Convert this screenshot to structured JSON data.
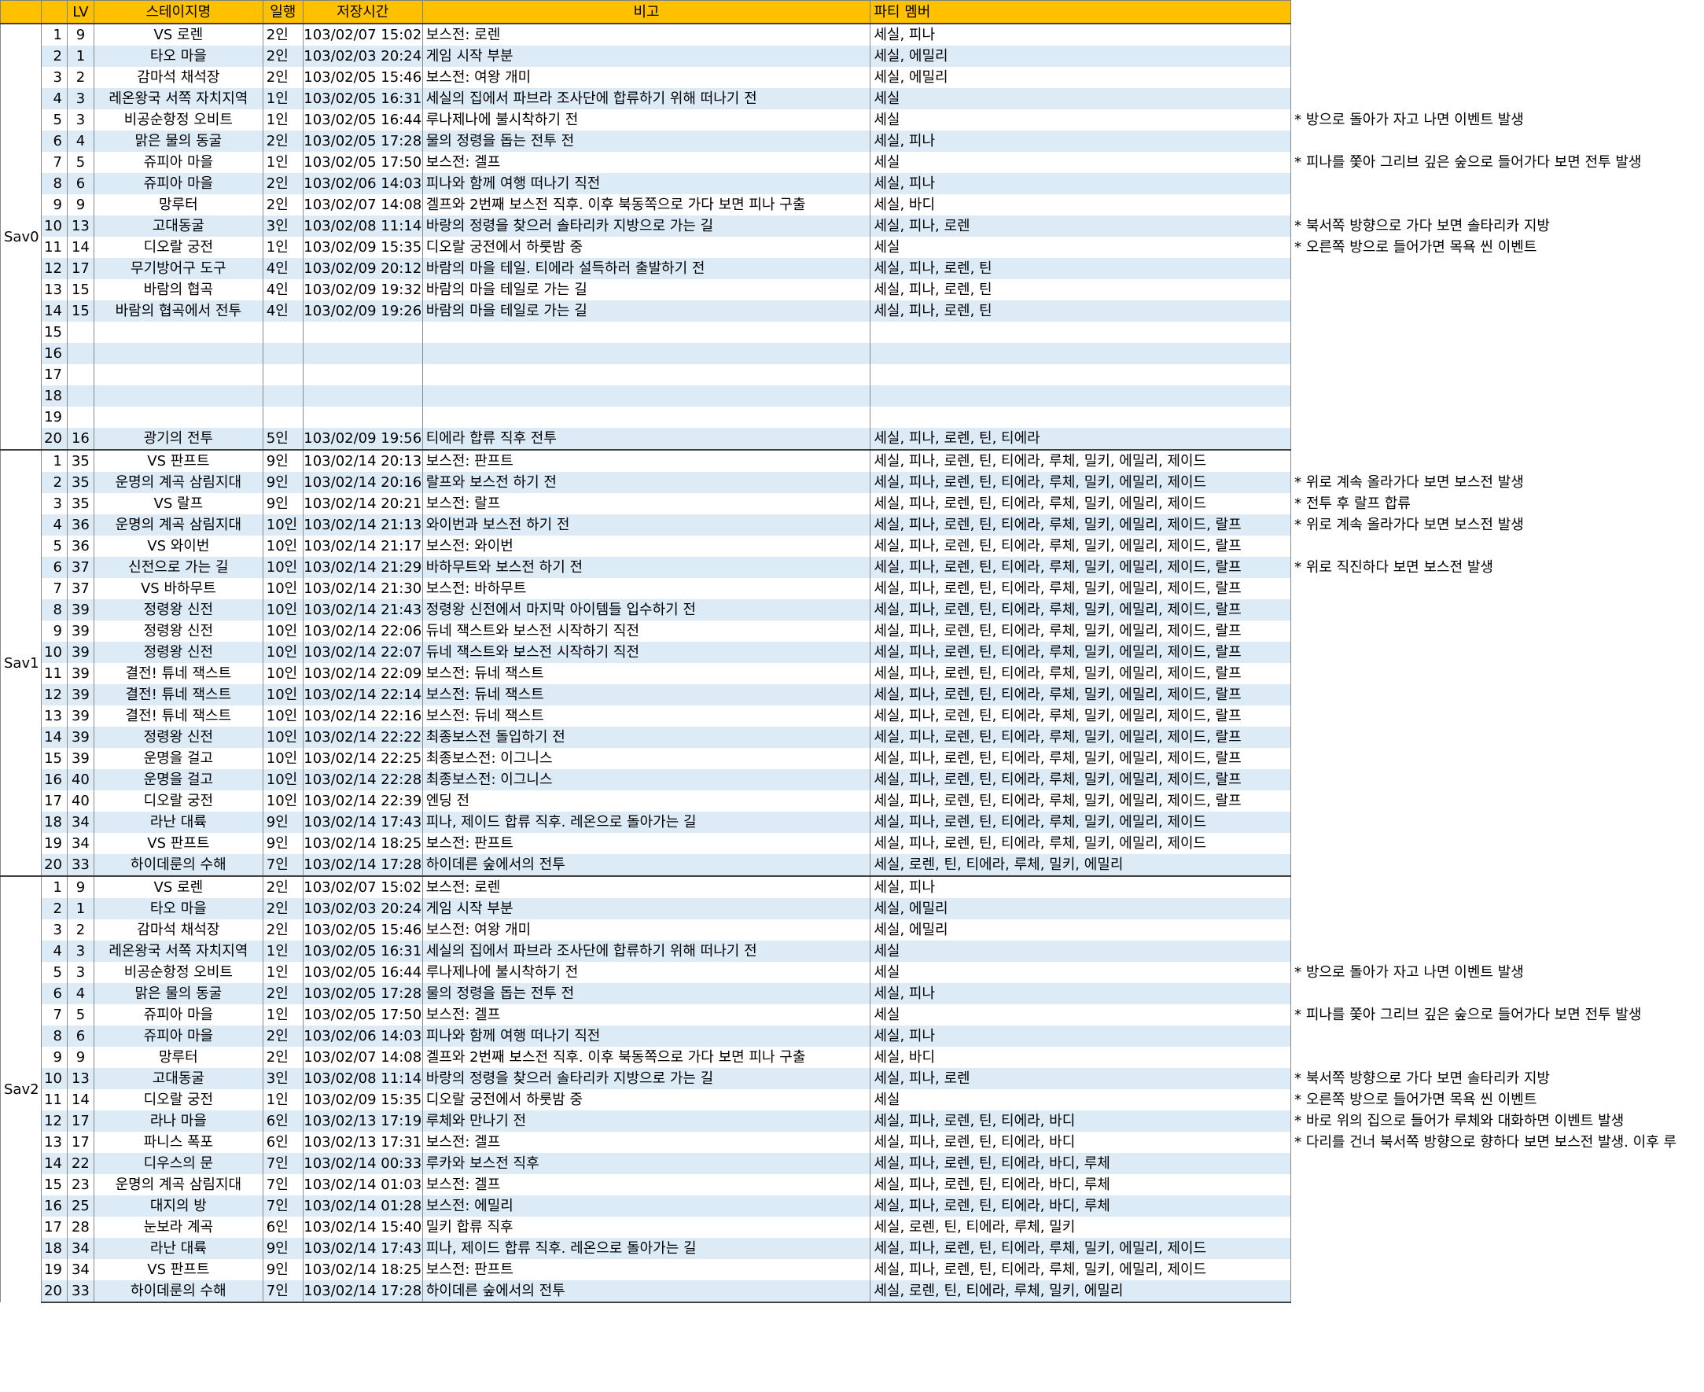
{
  "headers": {
    "blank": "",
    "no": "",
    "lv": "LV",
    "stage": "스테이지명",
    "party_count": "일행",
    "save_time": "저장시간",
    "remark": "비고",
    "party": "파티 멤버"
  },
  "groups": [
    {
      "name": "Sav0",
      "rows": [
        {
          "no": "1",
          "lv": "9",
          "stage": "VS 로렌",
          "cnt": "2인",
          "time": "103/02/07 15:02",
          "remark": "보스전: 로렌",
          "party": "세실, 피나",
          "note": ""
        },
        {
          "no": "2",
          "lv": "1",
          "stage": "타오 마을",
          "cnt": "2인",
          "time": "103/02/03 20:24",
          "remark": "게임 시작 부분",
          "party": "세실, 에밀리",
          "note": ""
        },
        {
          "no": "3",
          "lv": "2",
          "stage": "감마석 채석장",
          "cnt": "2인",
          "time": "103/02/05 15:46",
          "remark": "보스전: 여왕 개미",
          "party": "세실, 에밀리",
          "note": ""
        },
        {
          "no": "4",
          "lv": "3",
          "stage": "레온왕국 서쪽 자치지역",
          "cnt": "1인",
          "time": "103/02/05 16:31",
          "remark": "세실의 집에서 파브라 조사단에 합류하기 위해 떠나기 전",
          "party": "세실",
          "note": ""
        },
        {
          "no": "5",
          "lv": "3",
          "stage": "비공순항정 오비트",
          "cnt": "1인",
          "time": "103/02/05 16:44",
          "remark": "루나제나에 불시착하기 전",
          "party": "세실",
          "note": "* 방으로 돌아가 자고 나면 이벤트 발생"
        },
        {
          "no": "6",
          "lv": "4",
          "stage": "맑은 물의 동굴",
          "cnt": "2인",
          "time": "103/02/05 17:28",
          "remark": "물의 정령을 돕는 전투 전",
          "party": "세실, 피나",
          "note": ""
        },
        {
          "no": "7",
          "lv": "5",
          "stage": "쥬피아 마을",
          "cnt": "1인",
          "time": "103/02/05 17:50",
          "remark": "보스전: 겔프",
          "party": "세실",
          "note": "* 피나를 쫓아 그리브 깊은 숲으로 들어가다 보면 전투 발생"
        },
        {
          "no": "8",
          "lv": "6",
          "stage": "쥬피아 마을",
          "cnt": "2인",
          "time": "103/02/06 14:03",
          "remark": "피나와 함께 여행 떠나기 직전",
          "party": "세실, 피나",
          "note": ""
        },
        {
          "no": "9",
          "lv": "9",
          "stage": "망루터",
          "cnt": "2인",
          "time": "103/02/07 14:08",
          "remark": "겔프와 2번째 보스전 직후. 이후 북동쪽으로 가다 보면 피나 구출",
          "party": "세실, 바디",
          "note": ""
        },
        {
          "no": "10",
          "lv": "13",
          "stage": "고대동굴",
          "cnt": "3인",
          "time": "103/02/08 11:14",
          "remark": "바랑의 정령을 찾으러 솔타리카 지방으로 가는 길",
          "party": "세실, 피나, 로렌",
          "note": "* 북서쪽 방향으로 가다 보면 솔타리카 지방"
        },
        {
          "no": "11",
          "lv": "14",
          "stage": "디오랄 궁전",
          "cnt": "1인",
          "time": "103/02/09 15:35",
          "remark": "디오랄 궁전에서 하룻밤 중",
          "party": "세실",
          "note": "* 오른쪽 방으로 들어가면 목욕 씬 이벤트"
        },
        {
          "no": "12",
          "lv": "17",
          "stage": "무기방어구 도구",
          "cnt": "4인",
          "time": "103/02/09 20:12",
          "remark": "바람의 마을 테일. 티에라 설득하러 출발하기 전",
          "party": "세실, 피나, 로렌, 틴",
          "note": ""
        },
        {
          "no": "13",
          "lv": "15",
          "stage": "바람의 협곡",
          "cnt": "4인",
          "time": "103/02/09 19:32",
          "remark": "바람의 마을 테일로 가는 길",
          "party": "세실, 피나, 로렌, 틴",
          "note": ""
        },
        {
          "no": "14",
          "lv": "15",
          "stage": "바람의 협곡에서 전투",
          "cnt": "4인",
          "time": "103/02/09 19:26",
          "remark": "바람의 마을 테일로 가는 길",
          "party": "세실, 피나, 로렌, 틴",
          "note": ""
        },
        {
          "no": "15",
          "lv": "",
          "stage": "",
          "cnt": "",
          "time": "",
          "remark": "",
          "party": "",
          "note": ""
        },
        {
          "no": "16",
          "lv": "",
          "stage": "",
          "cnt": "",
          "time": "",
          "remark": "",
          "party": "",
          "note": ""
        },
        {
          "no": "17",
          "lv": "",
          "stage": "",
          "cnt": "",
          "time": "",
          "remark": "",
          "party": "",
          "note": ""
        },
        {
          "no": "18",
          "lv": "",
          "stage": "",
          "cnt": "",
          "time": "",
          "remark": "",
          "party": "",
          "note": ""
        },
        {
          "no": "19",
          "lv": "",
          "stage": "",
          "cnt": "",
          "time": "",
          "remark": "",
          "party": "",
          "note": ""
        },
        {
          "no": "20",
          "lv": "16",
          "stage": "광기의 전투",
          "cnt": "5인",
          "time": "103/02/09 19:56",
          "remark": "티에라 합류 직후 전투",
          "party": "세실, 피나, 로렌, 틴, 티에라",
          "note": ""
        }
      ]
    },
    {
      "name": "Sav1",
      "rows": [
        {
          "no": "1",
          "lv": "35",
          "stage": "VS 판프트",
          "cnt": "9인",
          "time": "103/02/14 20:13",
          "remark": "보스전: 판프트",
          "party": "세실, 피나, 로렌, 틴, 티에라, 루체, 밀키, 에밀리, 제이드",
          "note": ""
        },
        {
          "no": "2",
          "lv": "35",
          "stage": "운명의 계곡 삼림지대",
          "cnt": "9인",
          "time": "103/02/14 20:16",
          "remark": "랄프와 보스전 하기 전",
          "party": "세실, 피나, 로렌, 틴, 티에라, 루체, 밀키, 에밀리, 제이드",
          "note": "* 위로 계속 올라가다 보면 보스전 발생"
        },
        {
          "no": "3",
          "lv": "35",
          "stage": "VS 랄프",
          "cnt": "9인",
          "time": "103/02/14 20:21",
          "remark": "보스전: 랄프",
          "party": "세실, 피나, 로렌, 틴, 티에라, 루체, 밀키, 에밀리, 제이드",
          "note": "* 전투 후 랄프 합류"
        },
        {
          "no": "4",
          "lv": "36",
          "stage": "운명의 계곡 삼림지대",
          "cnt": "10인",
          "time": "103/02/14 21:13",
          "remark": "와이번과 보스전 하기 전",
          "party": "세실, 피나, 로렌, 틴, 티에라, 루체, 밀키, 에밀리, 제이드, 랄프",
          "note": "* 위로 계속 올라가다 보면 보스전 발생"
        },
        {
          "no": "5",
          "lv": "36",
          "stage": "VS 와이번",
          "cnt": "10인",
          "time": "103/02/14 21:17",
          "remark": "보스전: 와이번",
          "party": "세실, 피나, 로렌, 틴, 티에라, 루체, 밀키, 에밀리, 제이드, 랄프",
          "note": ""
        },
        {
          "no": "6",
          "lv": "37",
          "stage": "신전으로 가는 길",
          "cnt": "10인",
          "time": "103/02/14 21:29",
          "remark": "바하무트와 보스전 하기 전",
          "party": "세실, 피나, 로렌, 틴, 티에라, 루체, 밀키, 에밀리, 제이드, 랄프",
          "note": "* 위로 직진하다 보면 보스전 발생"
        },
        {
          "no": "7",
          "lv": "37",
          "stage": "VS 바하무트",
          "cnt": "10인",
          "time": "103/02/14 21:30",
          "remark": "보스전: 바하무트",
          "party": "세실, 피나, 로렌, 틴, 티에라, 루체, 밀키, 에밀리, 제이드, 랄프",
          "note": ""
        },
        {
          "no": "8",
          "lv": "39",
          "stage": "정령왕 신전",
          "cnt": "10인",
          "time": "103/02/14 21:43",
          "remark": "정령왕 신전에서 마지막 아이템들 입수하기 전",
          "party": "세실, 피나, 로렌, 틴, 티에라, 루체, 밀키, 에밀리, 제이드, 랄프",
          "note": ""
        },
        {
          "no": "9",
          "lv": "39",
          "stage": "정령왕 신전",
          "cnt": "10인",
          "time": "103/02/14 22:06",
          "remark": "듀네 잭스트와 보스전 시작하기 직전",
          "party": "세실, 피나, 로렌, 틴, 티에라, 루체, 밀키, 에밀리, 제이드, 랄프",
          "note": ""
        },
        {
          "no": "10",
          "lv": "39",
          "stage": "정령왕 신전",
          "cnt": "10인",
          "time": "103/02/14 22:07",
          "remark": "듀네 잭스트와 보스전 시작하기 직전",
          "party": "세실, 피나, 로렌, 틴, 티에라, 루체, 밀키, 에밀리, 제이드, 랄프",
          "note": ""
        },
        {
          "no": "11",
          "lv": "39",
          "stage": "결전! 튜네 잭스트",
          "cnt": "10인",
          "time": "103/02/14 22:09",
          "remark": "보스전: 듀네 잭스트",
          "party": "세실, 피나, 로렌, 틴, 티에라, 루체, 밀키, 에밀리, 제이드, 랄프",
          "note": ""
        },
        {
          "no": "12",
          "lv": "39",
          "stage": "결전! 튜네 잭스트",
          "cnt": "10인",
          "time": "103/02/14 22:14",
          "remark": "보스전: 듀네 잭스트",
          "party": "세실, 피나, 로렌, 틴, 티에라, 루체, 밀키, 에밀리, 제이드, 랄프",
          "note": ""
        },
        {
          "no": "13",
          "lv": "39",
          "stage": "결전! 튜네 잭스트",
          "cnt": "10인",
          "time": "103/02/14 22:16",
          "remark": "보스전: 듀네 잭스트",
          "party": "세실, 피나, 로렌, 틴, 티에라, 루체, 밀키, 에밀리, 제이드, 랄프",
          "note": ""
        },
        {
          "no": "14",
          "lv": "39",
          "stage": "정령왕 신전",
          "cnt": "10인",
          "time": "103/02/14 22:22",
          "remark": "최종보스전 돌입하기 전",
          "party": "세실, 피나, 로렌, 틴, 티에라, 루체, 밀키, 에밀리, 제이드, 랄프",
          "note": ""
        },
        {
          "no": "15",
          "lv": "39",
          "stage": "운명을 걸고",
          "cnt": "10인",
          "time": "103/02/14 22:25",
          "remark": "최종보스전: 이그니스",
          "party": "세실, 피나, 로렌, 틴, 티에라, 루체, 밀키, 에밀리, 제이드, 랄프",
          "note": ""
        },
        {
          "no": "16",
          "lv": "40",
          "stage": "운명을 걸고",
          "cnt": "10인",
          "time": "103/02/14 22:28",
          "remark": "최종보스전: 이그니스",
          "party": "세실, 피나, 로렌, 틴, 티에라, 루체, 밀키, 에밀리, 제이드, 랄프",
          "note": ""
        },
        {
          "no": "17",
          "lv": "40",
          "stage": "디오랄 궁전",
          "cnt": "10인",
          "time": "103/02/14 22:39",
          "remark": "엔딩 전",
          "party": "세실, 피나, 로렌, 틴, 티에라, 루체, 밀키, 에밀리, 제이드, 랄프",
          "note": ""
        },
        {
          "no": "18",
          "lv": "34",
          "stage": "라난 대륙",
          "cnt": "9인",
          "time": "103/02/14 17:43",
          "remark": "피나, 제이드 합류 직후. 레온으로 돌아가는 길",
          "party": "세실, 피나, 로렌, 틴, 티에라, 루체, 밀키, 에밀리, 제이드",
          "note": ""
        },
        {
          "no": "19",
          "lv": "34",
          "stage": "VS 판프트",
          "cnt": "9인",
          "time": "103/02/14 18:25",
          "remark": "보스전: 판프트",
          "party": "세실, 피나, 로렌, 틴, 티에라, 루체, 밀키, 에밀리, 제이드",
          "note": ""
        },
        {
          "no": "20",
          "lv": "33",
          "stage": "하이데룬의 수해",
          "cnt": "7인",
          "time": "103/02/14 17:28",
          "remark": "하이데른 숲에서의 전투",
          "party": "세실, 로렌, 틴, 티에라, 루체, 밀키, 에밀리",
          "note": ""
        }
      ]
    },
    {
      "name": "Sav2",
      "rows": [
        {
          "no": "1",
          "lv": "9",
          "stage": "VS 로렌",
          "cnt": "2인",
          "time": "103/02/07 15:02",
          "remark": "보스전: 로렌",
          "party": "세실, 피나",
          "note": ""
        },
        {
          "no": "2",
          "lv": "1",
          "stage": "타오 마을",
          "cnt": "2인",
          "time": "103/02/03 20:24",
          "remark": "게임 시작 부분",
          "party": "세실, 에밀리",
          "note": ""
        },
        {
          "no": "3",
          "lv": "2",
          "stage": "감마석 채석장",
          "cnt": "2인",
          "time": "103/02/05 15:46",
          "remark": "보스전: 여왕 개미",
          "party": "세실, 에밀리",
          "note": ""
        },
        {
          "no": "4",
          "lv": "3",
          "stage": "레온왕국 서쪽 자치지역",
          "cnt": "1인",
          "time": "103/02/05 16:31",
          "remark": "세실의 집에서 파브라 조사단에 합류하기 위해 떠나기 전",
          "party": "세실",
          "note": ""
        },
        {
          "no": "5",
          "lv": "3",
          "stage": "비공순항정 오비트",
          "cnt": "1인",
          "time": "103/02/05 16:44",
          "remark": "루나제나에 불시착하기 전",
          "party": "세실",
          "note": "* 방으로 돌아가 자고 나면 이벤트 발생"
        },
        {
          "no": "6",
          "lv": "4",
          "stage": "맑은 물의 동굴",
          "cnt": "2인",
          "time": "103/02/05 17:28",
          "remark": "물의 정령을 돕는 전투 전",
          "party": "세실, 피나",
          "note": ""
        },
        {
          "no": "7",
          "lv": "5",
          "stage": "쥬피아 마을",
          "cnt": "1인",
          "time": "103/02/05 17:50",
          "remark": "보스전: 겔프",
          "party": "세실",
          "note": "* 피나를 쫓아 그리브 깊은 숲으로 들어가다 보면 전투 발생"
        },
        {
          "no": "8",
          "lv": "6",
          "stage": "쥬피아 마을",
          "cnt": "2인",
          "time": "103/02/06 14:03",
          "remark": "피나와 함께 여행 떠나기 직전",
          "party": "세실, 피나",
          "note": ""
        },
        {
          "no": "9",
          "lv": "9",
          "stage": "망루터",
          "cnt": "2인",
          "time": "103/02/07 14:08",
          "remark": "겔프와 2번째 보스전 직후. 이후 북동쪽으로 가다 보면 피나 구출",
          "party": "세실, 바디",
          "note": ""
        },
        {
          "no": "10",
          "lv": "13",
          "stage": "고대동굴",
          "cnt": "3인",
          "time": "103/02/08 11:14",
          "remark": "바랑의 정령을 찾으러 솔타리카 지방으로 가는 길",
          "party": "세실, 피나, 로렌",
          "note": "* 북서쪽 방향으로 가다 보면 솔타리카 지방"
        },
        {
          "no": "11",
          "lv": "14",
          "stage": "디오랄 궁전",
          "cnt": "1인",
          "time": "103/02/09 15:35",
          "remark": "디오랄 궁전에서 하룻밤 중",
          "party": "세실",
          "note": "* 오른쪽 방으로 들어가면 목욕 씬 이벤트"
        },
        {
          "no": "12",
          "lv": "17",
          "stage": "라나 마을",
          "cnt": "6인",
          "time": "103/02/13 17:19",
          "remark": "루체와 만나기 전",
          "party": "세실, 피나, 로렌, 틴, 티에라, 바디",
          "note": "* 바로 위의 집으로 들어가 루체와 대화하면 이벤트 발생"
        },
        {
          "no": "13",
          "lv": "17",
          "stage": "파니스 폭포",
          "cnt": "6인",
          "time": "103/02/13 17:31",
          "remark": "보스전: 겔프",
          "party": "세실, 피나, 로렌, 틴, 티에라, 바디",
          "note": "* 다리를 건너 북서쪽 방향으로 향하다 보면 보스전 발생. 이후 루"
        },
        {
          "no": "14",
          "lv": "22",
          "stage": "디우스의 문",
          "cnt": "7인",
          "time": "103/02/14 00:33",
          "remark": "루카와 보스전 직후",
          "party": "세실, 피나, 로렌, 틴, 티에라, 바디, 루체",
          "note": ""
        },
        {
          "no": "15",
          "lv": "23",
          "stage": "운명의 계곡 삼림지대",
          "cnt": "7인",
          "time": "103/02/14 01:03",
          "remark": "보스전: 겔프",
          "party": "세실, 피나, 로렌, 틴, 티에라, 바디, 루체",
          "note": ""
        },
        {
          "no": "16",
          "lv": "25",
          "stage": "대지의 방",
          "cnt": "7인",
          "time": "103/02/14 01:28",
          "remark": "보스전: 에밀리",
          "party": "세실, 피나, 로렌, 틴, 티에라, 바디, 루체",
          "note": ""
        },
        {
          "no": "17",
          "lv": "28",
          "stage": "눈보라 계곡",
          "cnt": "6인",
          "time": "103/02/14 15:40",
          "remark": "밀키 합류 직후",
          "party": "세실, 로렌, 틴, 티에라, 루체, 밀키",
          "note": ""
        },
        {
          "no": "18",
          "lv": "34",
          "stage": "라난 대륙",
          "cnt": "9인",
          "time": "103/02/14 17:43",
          "remark": "피나, 제이드 합류 직후. 레온으로 돌아가는 길",
          "party": "세실, 피나, 로렌, 틴, 티에라, 루체, 밀키, 에밀리, 제이드",
          "note": ""
        },
        {
          "no": "19",
          "lv": "34",
          "stage": "VS 판프트",
          "cnt": "9인",
          "time": "103/02/14 18:25",
          "remark": "보스전: 판프트",
          "party": "세실, 피나, 로렌, 틴, 티에라, 루체, 밀키, 에밀리, 제이드",
          "note": ""
        },
        {
          "no": "20",
          "lv": "33",
          "stage": "하이데룬의 수해",
          "cnt": "7인",
          "time": "103/02/14 17:28",
          "remark": "하이데른 숲에서의 전투",
          "party": "세실, 로렌, 틴, 티에라, 루체, 밀키, 에밀리",
          "note": ""
        }
      ]
    }
  ],
  "colors": {
    "header_bg": "#FFC000",
    "stripe_bg": "#DDEBF7",
    "row_bg": "#FFFFFF"
  }
}
